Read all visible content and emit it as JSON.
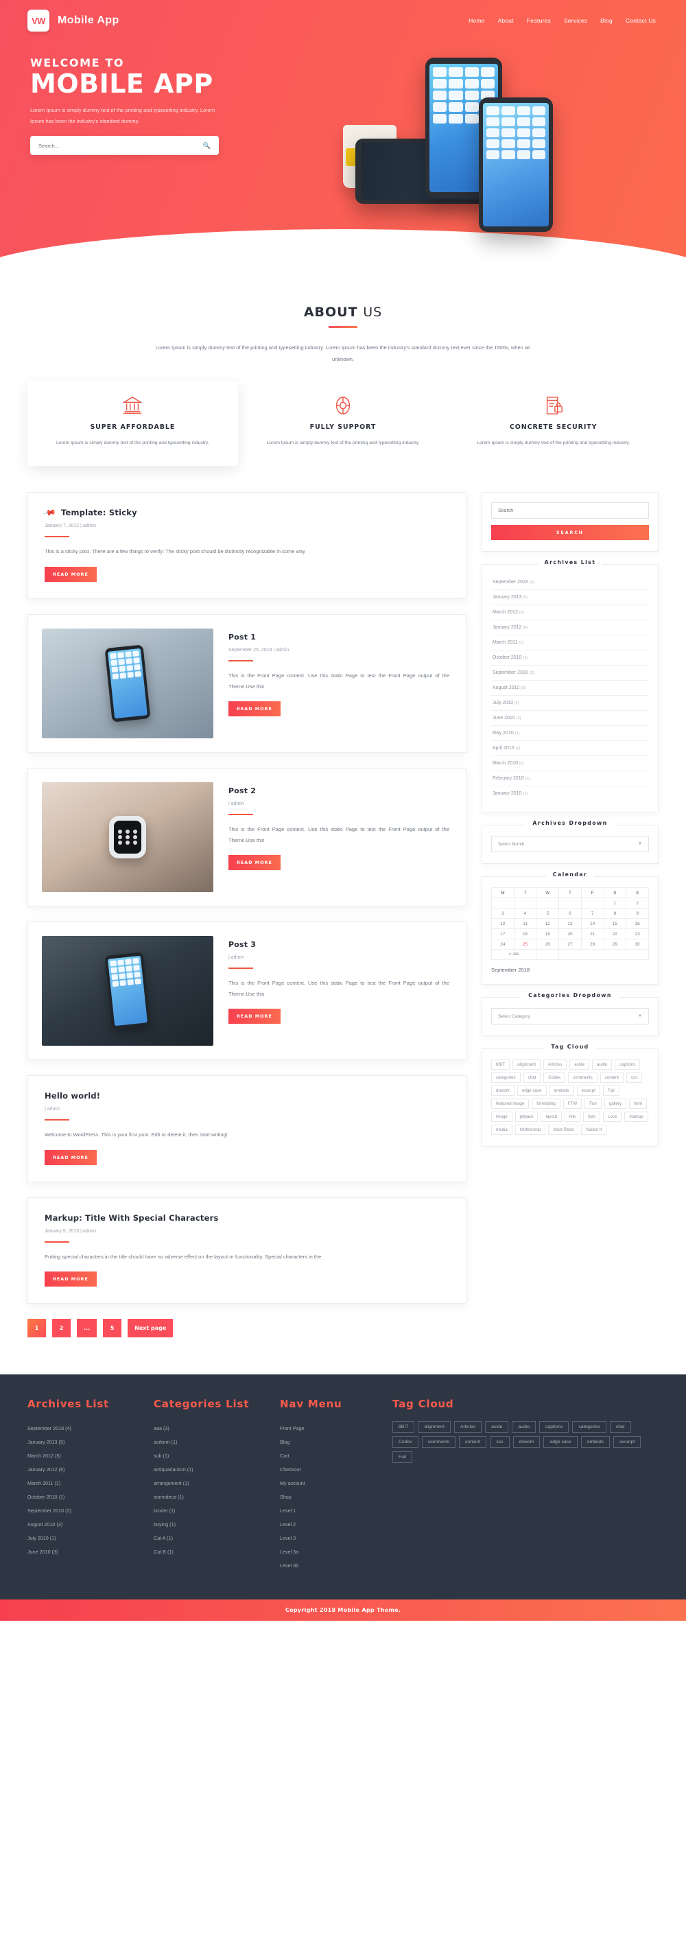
{
  "header": {
    "logo_initials": "VW",
    "brand": "Mobile App",
    "nav": [
      {
        "label": "Home"
      },
      {
        "label": "About"
      },
      {
        "label": "Features"
      },
      {
        "label": "Services"
      },
      {
        "label": "Blog"
      },
      {
        "label": "Contact Us"
      }
    ]
  },
  "hero": {
    "kicker": "WELCOME TO",
    "title": "MOBILE APP",
    "description": "Lorem Ipsum is simply dummy text of the printing and typesetting industry. Lorem Ipsum has been the industry's standard dummy.",
    "search_placeholder": "Search...",
    "search_value": "",
    "search_icon": "search-icon"
  },
  "about": {
    "title_bold": "ABOUT",
    "title_thin": "US",
    "copy": "Lorem Ipsum is simply dummy text of the printing and typesetting industry. Lorem Ipsum has been the industry's standard dummy text ever since the 1500s, when an unknown.",
    "features": [
      {
        "icon": "bank-icon",
        "title": "SUPER AFFORDABLE",
        "desc": "Lorem Ipsum is simply dummy text of the printing and typesetting industry."
      },
      {
        "icon": "lifebuoy-icon",
        "title": "FULLY SUPPORT",
        "desc": "Lorem Ipsum is simply dummy text of the printing and typesetting industry."
      },
      {
        "icon": "lock-book-icon",
        "title": "CONCRETE SECURITY",
        "desc": "Lorem Ipsum is simply dummy text of the printing and typesetting industry."
      }
    ]
  },
  "posts": [
    {
      "sticky": true,
      "pin_icon": "pushpin-icon",
      "title": "Template: Sticky",
      "date": "January 7, 2012",
      "separator": "|",
      "author": "admin",
      "excerpt": "This is a sticky post. There are a few things to verify: The sticky post should be distinctly recognizable in some way",
      "read_more": "READ MORE",
      "thumb": ""
    },
    {
      "sticky": false,
      "title": "Post 1",
      "date": "September 25, 2018",
      "separator": "|",
      "author": "admin",
      "excerpt": "This is the Front Page content. Use this static Page to test the Front Page output of the Theme.Use this",
      "read_more": "READ MORE",
      "thumb": "hand-holding-smartphone"
    },
    {
      "sticky": false,
      "title": "Post 2",
      "date": "",
      "separator": "|",
      "author": "admin",
      "excerpt": "This is the Front Page content. Use this static Page to test the Front Page output of the Theme.Use this",
      "read_more": "READ MORE",
      "thumb": "smartwatch-on-wrist"
    },
    {
      "sticky": false,
      "title": "Post 3",
      "date": "",
      "separator": "|",
      "author": "admin",
      "excerpt": "This is the Front Page content. Use this static Page to test the Front Page output of the Theme.Use this",
      "read_more": "READ MORE",
      "thumb": "hands-holding-phone-night"
    },
    {
      "sticky": false,
      "title": "Hello world!",
      "date": "",
      "separator": "|",
      "author": "admin",
      "excerpt": "Welcome to WordPress. This is your first post. Edit or delete it, then start writing!",
      "read_more": "READ MORE",
      "thumb": ""
    },
    {
      "sticky": false,
      "title": "Markup: Title With Special Characters",
      "date": "January 5, 2013",
      "separator": "|",
      "author": "admin",
      "excerpt": "Putting special characters in the title should have no adverse effect on the layout or functionality. Special characters in the",
      "read_more": "READ MORE",
      "thumb": ""
    }
  ],
  "pagination": [
    {
      "label": "1",
      "active": true
    },
    {
      "label": "2",
      "active": false
    },
    {
      "label": "...",
      "active": false
    },
    {
      "label": "5",
      "active": false
    },
    {
      "label": "Next page",
      "active": false
    }
  ],
  "sidebar": {
    "search": {
      "placeholder": "Search",
      "value": "",
      "button": "SEARCH"
    },
    "archives": {
      "title": "Archives List",
      "items": [
        {
          "label": "September 2018",
          "count": "(4)"
        },
        {
          "label": "January 2013",
          "count": "(5)"
        },
        {
          "label": "March 2012",
          "count": "(5)"
        },
        {
          "label": "January 2012",
          "count": "(6)"
        },
        {
          "label": "March 2011",
          "count": "(1)"
        },
        {
          "label": "October 2010",
          "count": "(1)"
        },
        {
          "label": "September 2010",
          "count": "(2)"
        },
        {
          "label": "August 2010",
          "count": "(3)"
        },
        {
          "label": "July 2010",
          "count": "(1)"
        },
        {
          "label": "June 2010",
          "count": "(3)"
        },
        {
          "label": "May 2010",
          "count": "(1)"
        },
        {
          "label": "April 2010",
          "count": "(1)"
        },
        {
          "label": "March 2010",
          "count": "(1)"
        },
        {
          "label": "February 2010",
          "count": "(1)"
        },
        {
          "label": "January 2010",
          "count": "(1)"
        }
      ]
    },
    "archives_dropdown": {
      "title": "Archives Dropdown",
      "selected": "Select Month",
      "caret": "chevron-down-icon"
    },
    "calendar": {
      "title": "Calendar",
      "weekdays": [
        "M",
        "T",
        "W",
        "T",
        "F",
        "S",
        "S"
      ],
      "weeks": [
        [
          "",
          "",
          "",
          "",
          "",
          "1",
          "2"
        ],
        [
          "3",
          "4",
          "5",
          "6",
          "7",
          "8",
          "9"
        ],
        [
          "10",
          "11",
          "12",
          "13",
          "14",
          "15",
          "16"
        ],
        [
          "17",
          "18",
          "19",
          "20",
          "21",
          "22",
          "23"
        ],
        [
          "24",
          "25",
          "26",
          "27",
          "28",
          "29",
          "30"
        ]
      ],
      "today": "25",
      "prev_link": "« Jan",
      "caption": "September 2018"
    },
    "categories_dropdown": {
      "title": "Categories Dropdown",
      "selected": "Select Category",
      "caret": "chevron-down-icon"
    },
    "tag_cloud": {
      "title": "Tag Cloud",
      "tags": [
        "8BIT",
        "alignment",
        "Articles",
        "aside",
        "audio",
        "captions",
        "categories",
        "chat",
        "Codex",
        "comments",
        "content",
        "css",
        "dowork",
        "edge case",
        "embeds",
        "excerpt",
        "Fail",
        "featured image",
        "formatting",
        "FTW",
        "Fun",
        "gallery",
        "html",
        "image",
        "jetpack",
        "layout",
        "link",
        "lists",
        "Love",
        "markup",
        "media",
        "Mothership",
        "Must Read",
        "Nailed It"
      ]
    }
  },
  "footer": {
    "archives": {
      "title": "Archives List",
      "items": [
        "September 2018 (4)",
        "January 2013 (5)",
        "March 2012 (5)",
        "January 2012 (6)",
        "March 2011 (1)",
        "October 2010 (1)",
        "September 2010 (2)",
        "August 2010 (3)",
        "July 2010 (1)",
        "June 2010 (3)"
      ]
    },
    "categories": {
      "title": "Categories List",
      "items": [
        "aaa (3)",
        "aciform (1)",
        "sub (1)",
        "antiquarianism (1)",
        "arrangement (1)",
        "asmodeus (1)",
        "broder (1)",
        "buying (1)",
        "Cat A (1)",
        "Cat B (1)"
      ]
    },
    "nav": {
      "title": "Nav Menu",
      "items": [
        "Front Page",
        "Blog",
        "Cart",
        "Checkout",
        "My account",
        "Shop",
        "Level 1",
        "Level 2",
        "Level 3",
        "Level 3a",
        "Level 3b"
      ]
    },
    "tag_cloud": {
      "title": "Tag Cloud",
      "tags": [
        "8BIT",
        "alignment",
        "Articles",
        "aside",
        "audio",
        "captions",
        "categories",
        "chat",
        "Codex",
        "comments",
        "content",
        "css",
        "dowork",
        "edge case",
        "embeds",
        "excerpt",
        "Fail"
      ]
    },
    "copyright": "Copyright 2018 Mobile App Theme."
  },
  "colors": {
    "accent": "#fb4d59",
    "accent2": "#fd7b4e",
    "dark": "#2f3643"
  }
}
